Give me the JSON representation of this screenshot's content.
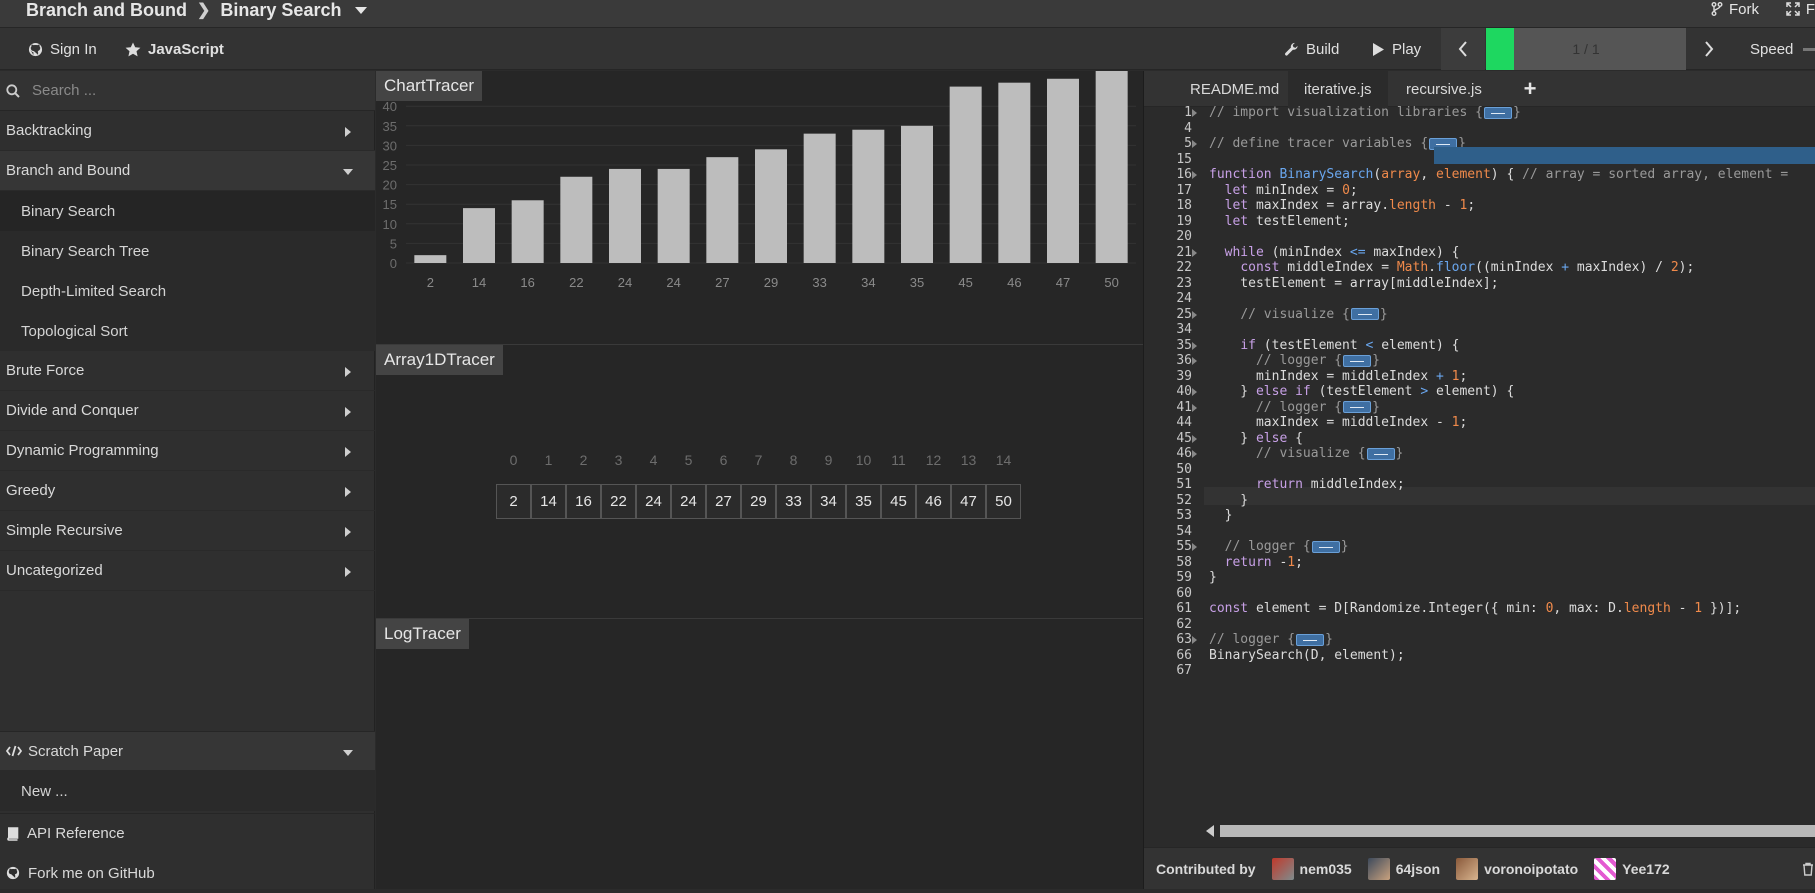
{
  "header": {
    "category": "Branch and Bound",
    "algorithm": "Binary Search",
    "fork_label": "Fork",
    "fullscreen_label": "F"
  },
  "toolbar": {
    "signin_label": "Sign In",
    "language_label": "JavaScript",
    "build_label": "Build",
    "play_label": "Play",
    "progress_text": "1 / 1",
    "progress_fraction": 0.14,
    "speed_label": "Speed"
  },
  "sidebar": {
    "search_placeholder": "Search ...",
    "categories": [
      {
        "label": "Backtracking"
      },
      {
        "label": "Branch and Bound"
      },
      {
        "label": "Brute Force"
      },
      {
        "label": "Divide and Conquer"
      },
      {
        "label": "Dynamic Programming"
      },
      {
        "label": "Greedy"
      },
      {
        "label": "Simple Recursive"
      },
      {
        "label": "Uncategorized"
      }
    ],
    "sub_items": [
      "Binary Search",
      "Binary Search Tree",
      "Depth-Limited Search",
      "Topological Sort"
    ],
    "scratch_label": "Scratch Paper",
    "new_label": "New ...",
    "api_label": "API Reference",
    "github_label": "Fork me on GitHub"
  },
  "tracers": {
    "chart_title": "ChartTracer",
    "array_title": "Array1DTracer",
    "log_title": "LogTracer"
  },
  "chart_data": {
    "type": "bar",
    "categories": [
      "2",
      "14",
      "16",
      "22",
      "24",
      "24",
      "27",
      "29",
      "33",
      "34",
      "35",
      "45",
      "46",
      "47",
      "50"
    ],
    "values": [
      2,
      14,
      16,
      22,
      24,
      24,
      27,
      29,
      33,
      34,
      35,
      45,
      46,
      47,
      50
    ],
    "yticks": [
      "0",
      "5",
      "10",
      "15",
      "20",
      "25",
      "30",
      "35",
      "40"
    ],
    "ylim": [
      0,
      50
    ],
    "grid": true
  },
  "array": {
    "indices": [
      "0",
      "1",
      "2",
      "3",
      "4",
      "5",
      "6",
      "7",
      "8",
      "9",
      "10",
      "11",
      "12",
      "13",
      "14"
    ],
    "values": [
      "2",
      "14",
      "16",
      "22",
      "24",
      "24",
      "27",
      "29",
      "33",
      "34",
      "35",
      "45",
      "46",
      "47",
      "50"
    ]
  },
  "editor": {
    "tabs": [
      "README.md",
      "iterative.js",
      "recursive.js"
    ],
    "add_tab": "+",
    "line_numbers": [
      "1",
      "4",
      "5",
      "15",
      "16",
      "17",
      "18",
      "19",
      "20",
      "21",
      "22",
      "23",
      "24",
      "25",
      "34",
      "35",
      "36",
      "39",
      "40",
      "41",
      "44",
      "45",
      "46",
      "50",
      "51",
      "52",
      "53",
      "54",
      "55",
      "58",
      "59",
      "60",
      "61",
      "62",
      "63",
      "66",
      "67"
    ]
  },
  "footer": {
    "contributed_by": "Contributed by",
    "contributors": [
      "nem035",
      "64json",
      "voronoipotato",
      "Yee172"
    ]
  },
  "colors": {
    "accent_green": "#1ed760",
    "bar_fill": "#bdbdbd",
    "highlight_blue": "#2f5f8a"
  }
}
